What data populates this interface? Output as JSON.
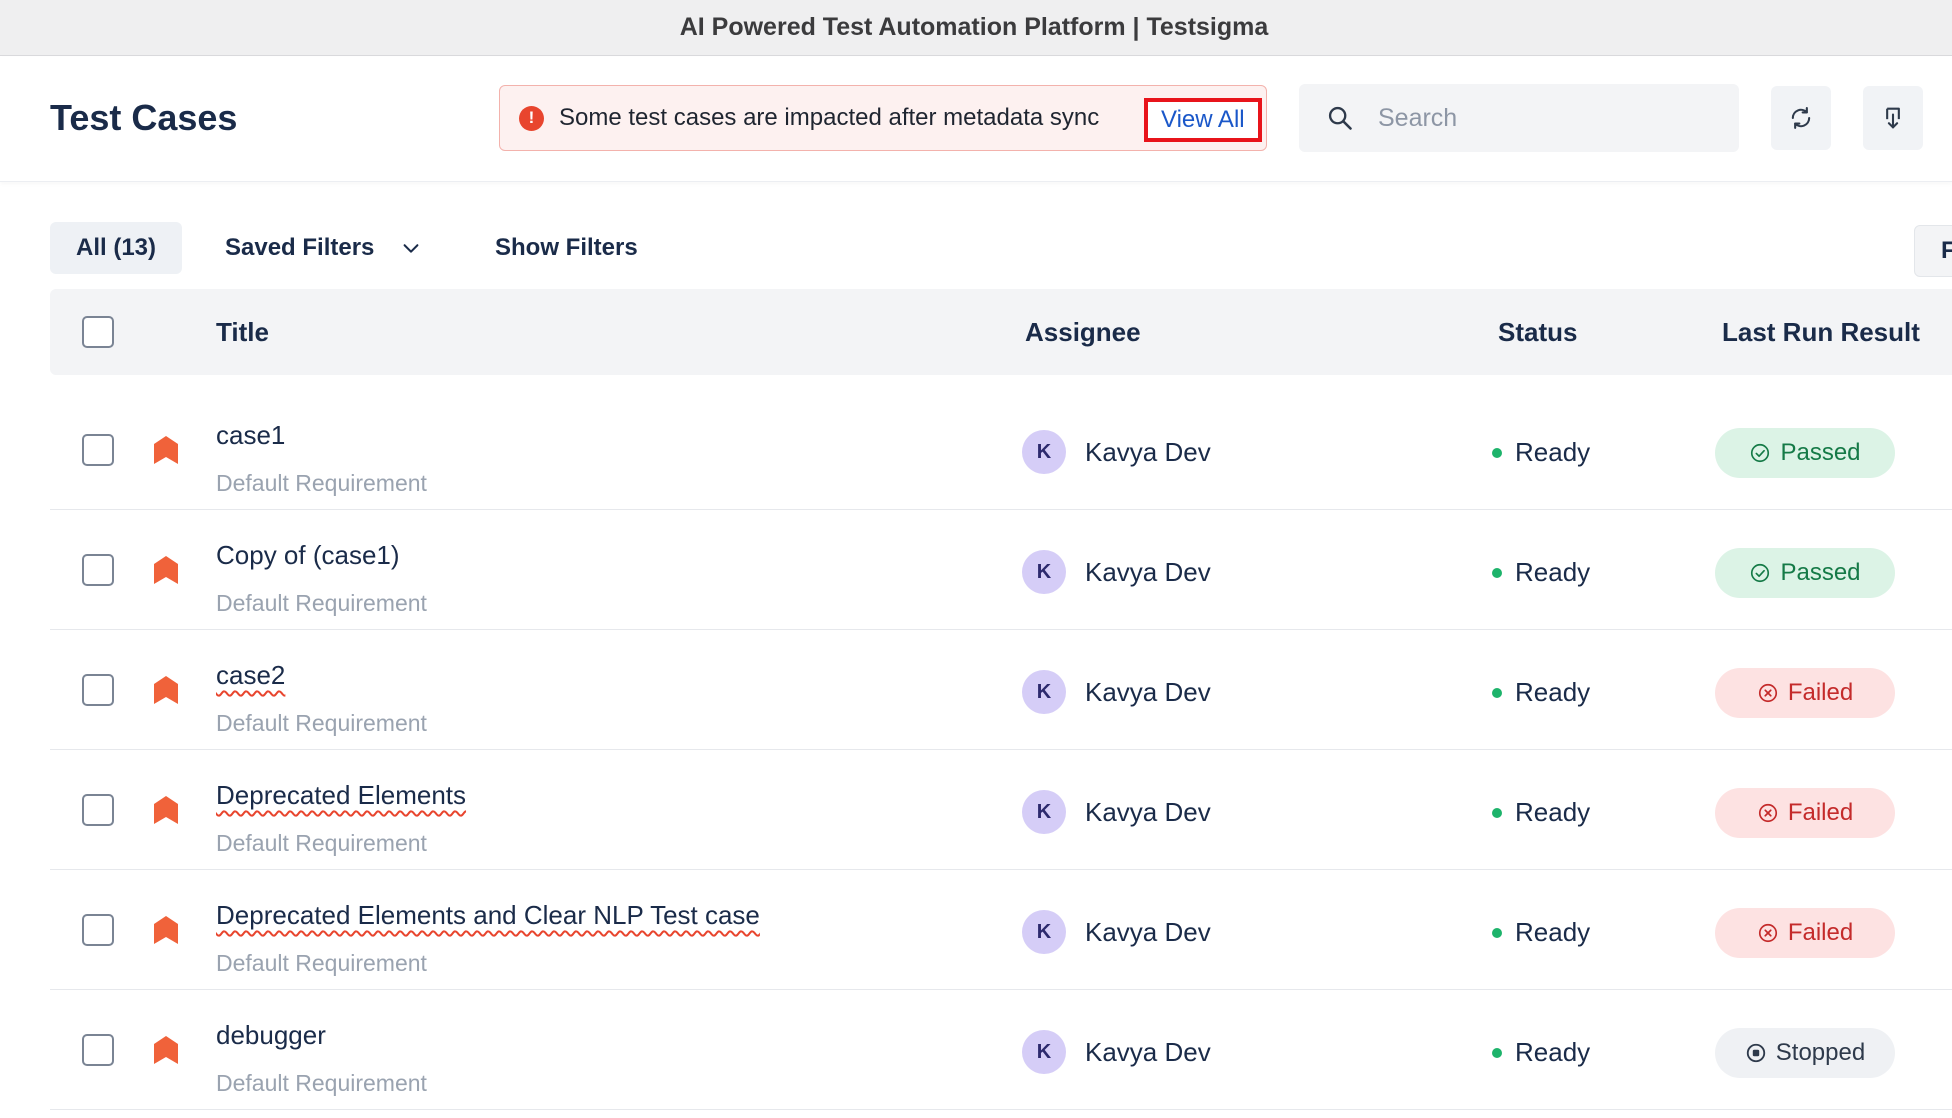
{
  "window": {
    "title": "AI Powered Test Automation Platform | Testsigma"
  },
  "header": {
    "page_title": "Test Cases",
    "alert": {
      "text": "Some test cases are impacted after metadata sync",
      "link": "View All"
    },
    "search": {
      "placeholder": "Search",
      "value": ""
    },
    "icons": [
      "refresh-icon",
      "download-icon"
    ]
  },
  "toolbar": {
    "all_tab": "All (13)",
    "saved_filters": "Saved Filters",
    "show_filters": "Show Filters",
    "edge_button": "F"
  },
  "table": {
    "columns": {
      "title": "Title",
      "assignee": "Assignee",
      "status": "Status",
      "last_run": "Last Run Result"
    },
    "rows": [
      {
        "title": "case1",
        "requirement": "Default Requirement",
        "assignee_initial": "K",
        "assignee": "Kavya Dev",
        "status": "Ready",
        "result": "Passed",
        "result_type": "passed",
        "squiggle": false
      },
      {
        "title": "Copy of (case1)",
        "requirement": "Default Requirement",
        "assignee_initial": "K",
        "assignee": "Kavya Dev",
        "status": "Ready",
        "result": "Passed",
        "result_type": "passed",
        "squiggle": false
      },
      {
        "title": "case2",
        "requirement": "Default Requirement",
        "assignee_initial": "K",
        "assignee": "Kavya Dev",
        "status": "Ready",
        "result": "Failed",
        "result_type": "failed",
        "squiggle": true
      },
      {
        "title": "Deprecated Elements",
        "requirement": "Default Requirement",
        "assignee_initial": "K",
        "assignee": "Kavya Dev",
        "status": "Ready",
        "result": "Failed",
        "result_type": "failed",
        "squiggle": true
      },
      {
        "title": "Deprecated Elements and Clear NLP Test case",
        "requirement": "Default Requirement",
        "assignee_initial": "K",
        "assignee": "Kavya Dev",
        "status": "Ready",
        "result": "Failed",
        "result_type": "failed",
        "squiggle": true
      },
      {
        "title": "debugger",
        "requirement": "Default Requirement",
        "assignee_initial": "K",
        "assignee": "Kavya Dev",
        "status": "Ready",
        "result": "Stopped",
        "result_type": "stopped",
        "squiggle": false
      }
    ]
  },
  "colors": {
    "accent": "#1a57c9",
    "priority_flag": "#f0623a",
    "ready_dot": "#1db36b"
  }
}
